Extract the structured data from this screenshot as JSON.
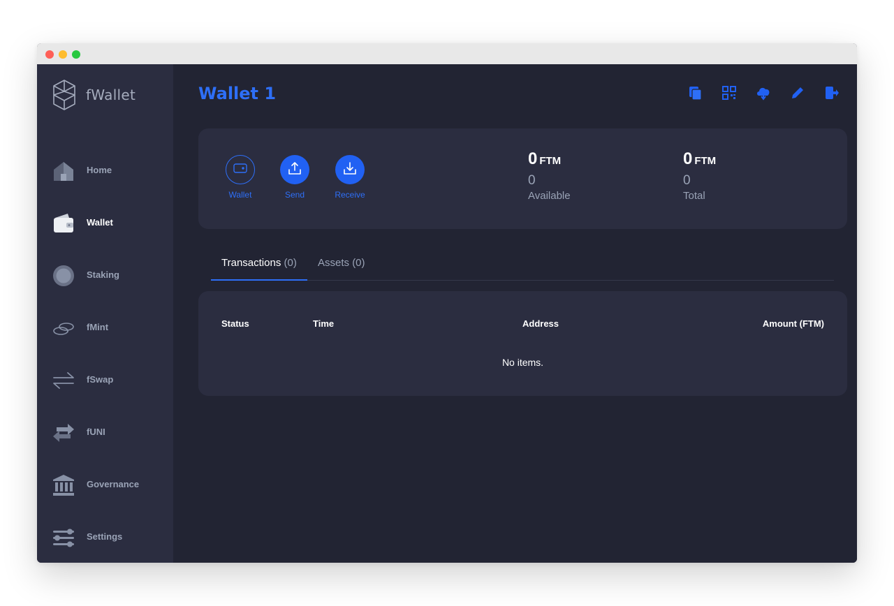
{
  "app": {
    "name": "fWallet"
  },
  "sidebar": {
    "items": [
      {
        "label": "Home",
        "icon": "home-icon",
        "active": false
      },
      {
        "label": "Wallet",
        "icon": "wallet-icon",
        "active": true
      },
      {
        "label": "Staking",
        "icon": "staking-icon",
        "active": false
      },
      {
        "label": "fMint",
        "icon": "coins-icon",
        "active": false
      },
      {
        "label": "fSwap",
        "icon": "swap-arrows-icon",
        "active": false
      },
      {
        "label": "fUNI",
        "icon": "transfer-arrows-icon",
        "active": false
      },
      {
        "label": "Governance",
        "icon": "bank-icon",
        "active": false
      },
      {
        "label": "Settings",
        "icon": "sliders-icon",
        "active": false
      }
    ]
  },
  "header": {
    "title": "Wallet 1",
    "actions": [
      "copy-icon",
      "qr-code-icon",
      "cloud-download-icon",
      "pencil-icon",
      "logout-icon"
    ]
  },
  "balance_card": {
    "actions": [
      {
        "label": "Wallet",
        "icon": "wallet-icon"
      },
      {
        "label": "Send",
        "icon": "upload-icon"
      },
      {
        "label": "Receive",
        "icon": "download-icon"
      }
    ],
    "available": {
      "amount": "0",
      "unit": "FTM",
      "secondary": "0",
      "caption": "Available"
    },
    "total": {
      "amount": "0",
      "unit": "FTM",
      "secondary": "0",
      "caption": "Total"
    }
  },
  "tabs": [
    {
      "name": "Transactions",
      "count": "(0)",
      "active": true
    },
    {
      "name": "Assets",
      "count": "(0)",
      "active": false
    }
  ],
  "table": {
    "columns": [
      "Status",
      "Time",
      "Address",
      "Amount (FTM)"
    ],
    "empty_text": "No items."
  },
  "colors": {
    "accent": "#2e6ff7",
    "background": "#222433",
    "panel": "#2b2d40",
    "muted_text": "#9aa3b6"
  }
}
